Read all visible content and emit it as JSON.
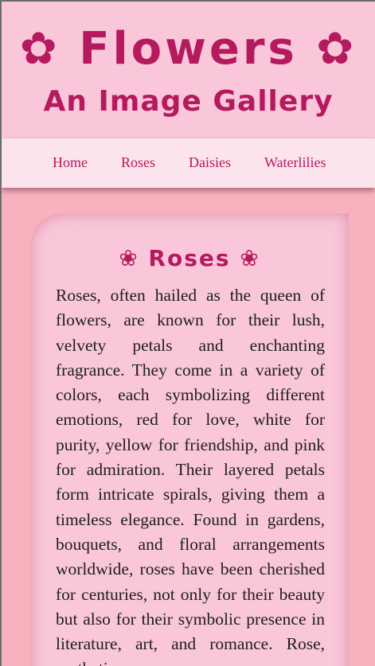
{
  "header": {
    "title": "✿ Flowers ✿",
    "subtitle": "An Image Gallery"
  },
  "nav": {
    "items": [
      {
        "label": "Home"
      },
      {
        "label": "Roses"
      },
      {
        "label": "Daisies"
      },
      {
        "label": "Waterlilies"
      }
    ]
  },
  "section": {
    "heading": "❀ Roses ❀",
    "body": "Roses, often hailed as the queen of flowers, are known for their lush, velvety petals and enchanting fragrance. They come in a variety of colors, each symbolizing different emotions, red for love, white for purity, yellow for friendship, and pink for admiration. Their layered petals form intricate spirals, giving them a timeless elegance. Found in gardens, bouquets, and floral arrangements worldwide, roses have been cherished for centuries, not only for their beauty but also for their symbolic presence in literature, art, and romance. Rose, aesthetic"
  },
  "colors": {
    "accent": "#b5195e",
    "header_bg": "#f9c7d9",
    "nav_bg": "#fce4ec",
    "page_bg": "#f7b2bd"
  }
}
